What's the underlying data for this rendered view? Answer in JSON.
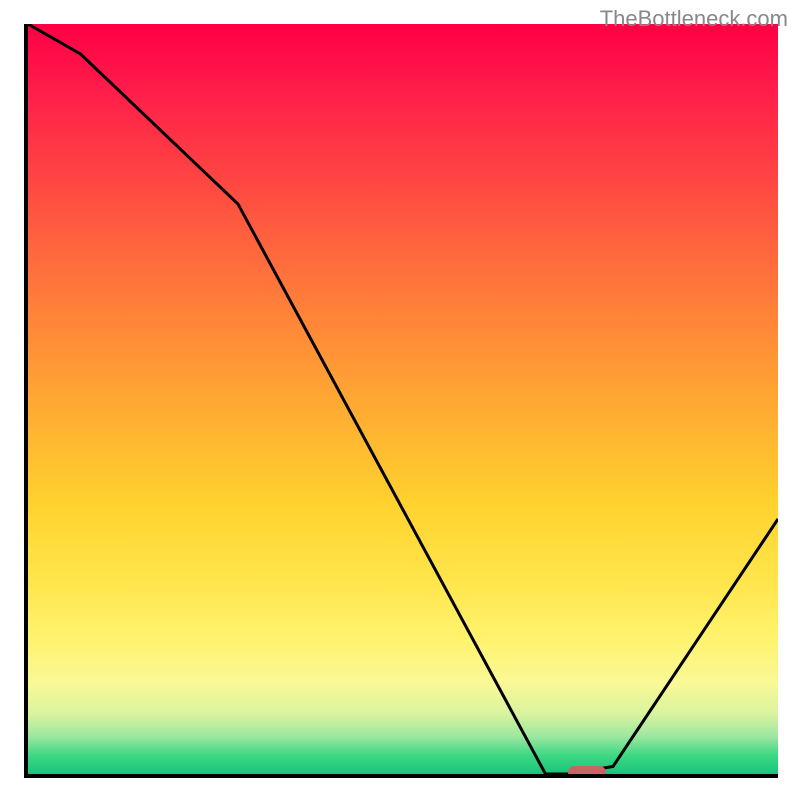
{
  "watermark": "TheBottleneck.com",
  "chart_data": {
    "type": "line",
    "x": [
      0,
      7,
      28,
      69,
      72,
      78,
      100
    ],
    "values": [
      100,
      96,
      76,
      0,
      0,
      1,
      34
    ],
    "xlim": [
      0,
      100
    ],
    "ylim": [
      0,
      100
    ],
    "title": "",
    "xlabel": "",
    "ylabel": "",
    "marker": {
      "x_start": 72,
      "x_end": 77,
      "y": 0
    },
    "gradient": "red-to-green vertical",
    "axes": "left and bottom only, no ticks"
  }
}
